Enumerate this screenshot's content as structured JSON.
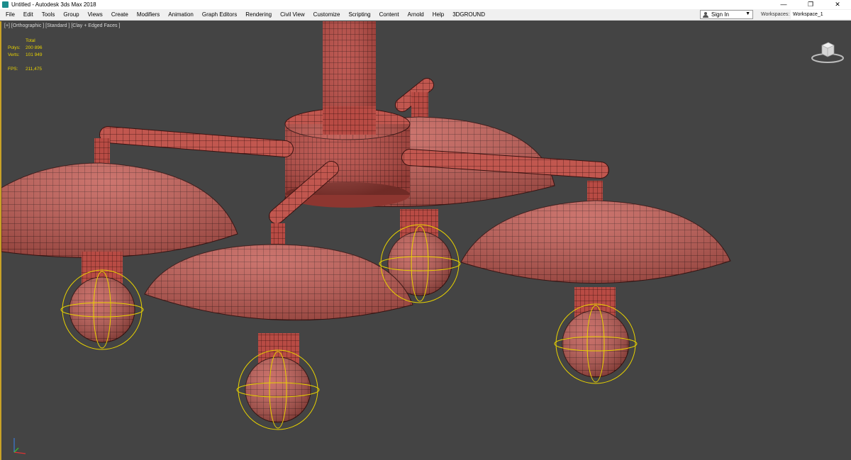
{
  "window": {
    "title": "Untitled - Autodesk 3ds Max 2018",
    "controls": {
      "minimize": "—",
      "maximize": "❐",
      "close": "✕"
    }
  },
  "menubar": {
    "items": [
      "File",
      "Edit",
      "Tools",
      "Group",
      "Views",
      "Create",
      "Modifiers",
      "Animation",
      "Graph Editors",
      "Rendering",
      "Civil View",
      "Customize",
      "Scripting",
      "Content",
      "Arnold",
      "Help",
      "3DGROUND"
    ],
    "sign_in": "Sign In",
    "workspaces_label": "Workspaces:",
    "workspace_value": "Workspace_1"
  },
  "viewport": {
    "label": "[+] [Orthographic ] [Standard ] [Clay + Edged Faces ]",
    "stats": {
      "header": "Total",
      "polys_label": "Polys:",
      "polys_value": "200 896",
      "verts_label": "Verts:",
      "verts_value": "101 949",
      "fps_label": "FPS:",
      "fps_value": "211,475"
    }
  },
  "colors": {
    "viewport_bg": "#444444",
    "clay": "#c1574f",
    "wire": "#3a1210",
    "selection": "#e8d200",
    "menubar_bg": "#f0f0f0"
  },
  "icons": {
    "viewcube": "viewcube-icon",
    "axis": "axis-tripod-icon",
    "user": "user-icon",
    "app": "3dsmax-app-icon"
  }
}
